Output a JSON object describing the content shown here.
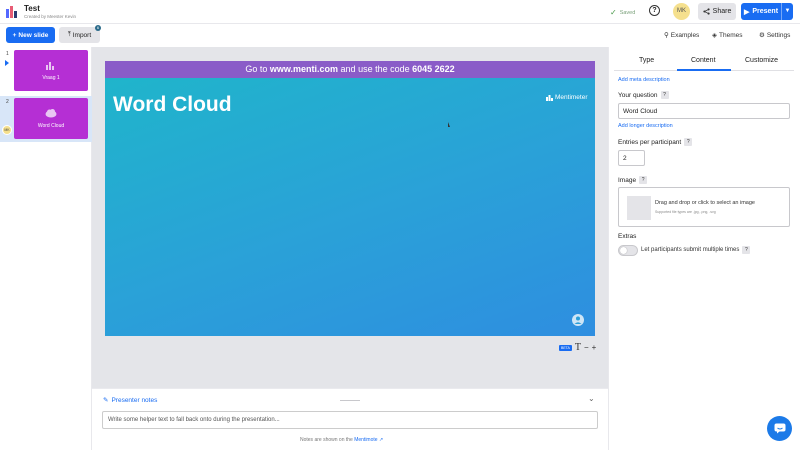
{
  "header": {
    "title": "Test",
    "subtitle": "Created by Meester Kevin",
    "saved_label": "Saved",
    "help_label": "?",
    "avatar_initials": "MK",
    "share_label": "Share",
    "present_label": "Present"
  },
  "toolbar": {
    "new_slide_label": "New slide",
    "import_label": "Import",
    "import_badge": "6",
    "examples_label": "Examples",
    "themes_label": "Themes",
    "settings_label": "Settings"
  },
  "slides": [
    {
      "number": "1",
      "label": "Vraag 1"
    },
    {
      "number": "2",
      "label": "Word Cloud",
      "avatar": "MK"
    }
  ],
  "canvas": {
    "code_prefix": "Go to ",
    "code_site": "www.menti.com",
    "code_middle": " and use the code ",
    "code_number": "6045 2622",
    "slide_title": "Word Cloud",
    "brand": "Mentimeter",
    "beta_label": "BETA",
    "zoom_minus": "−",
    "zoom_plus": "+"
  },
  "notes": {
    "header": "Presenter notes",
    "placeholder": "Write some helper text to fall back onto during the presentation...",
    "footer_prefix": "Notes are shown on the ",
    "footer_link": "Mentimote"
  },
  "panel": {
    "tabs": [
      "Type",
      "Content",
      "Customize"
    ],
    "active_tab": "Content",
    "add_meta": "Add meta description",
    "question_label": "Your question",
    "question_value": "Word Cloud",
    "add_longer": "Add longer description",
    "entries_label": "Entries per participant",
    "entries_value": "2",
    "image_label": "Image",
    "image_drop": "Drag and drop or click to select an image",
    "image_sub": "Supported file types are .jpg, .png, .svg",
    "extras_label": "Extras",
    "toggle_label": "Let participants submit multiple times",
    "toggle_on": false
  },
  "colors": {
    "accent": "#196cf2",
    "slide_thumb": "#b52fd4",
    "code_bar": "#8a5cc8",
    "slide_bg": "#2aa1d8"
  }
}
